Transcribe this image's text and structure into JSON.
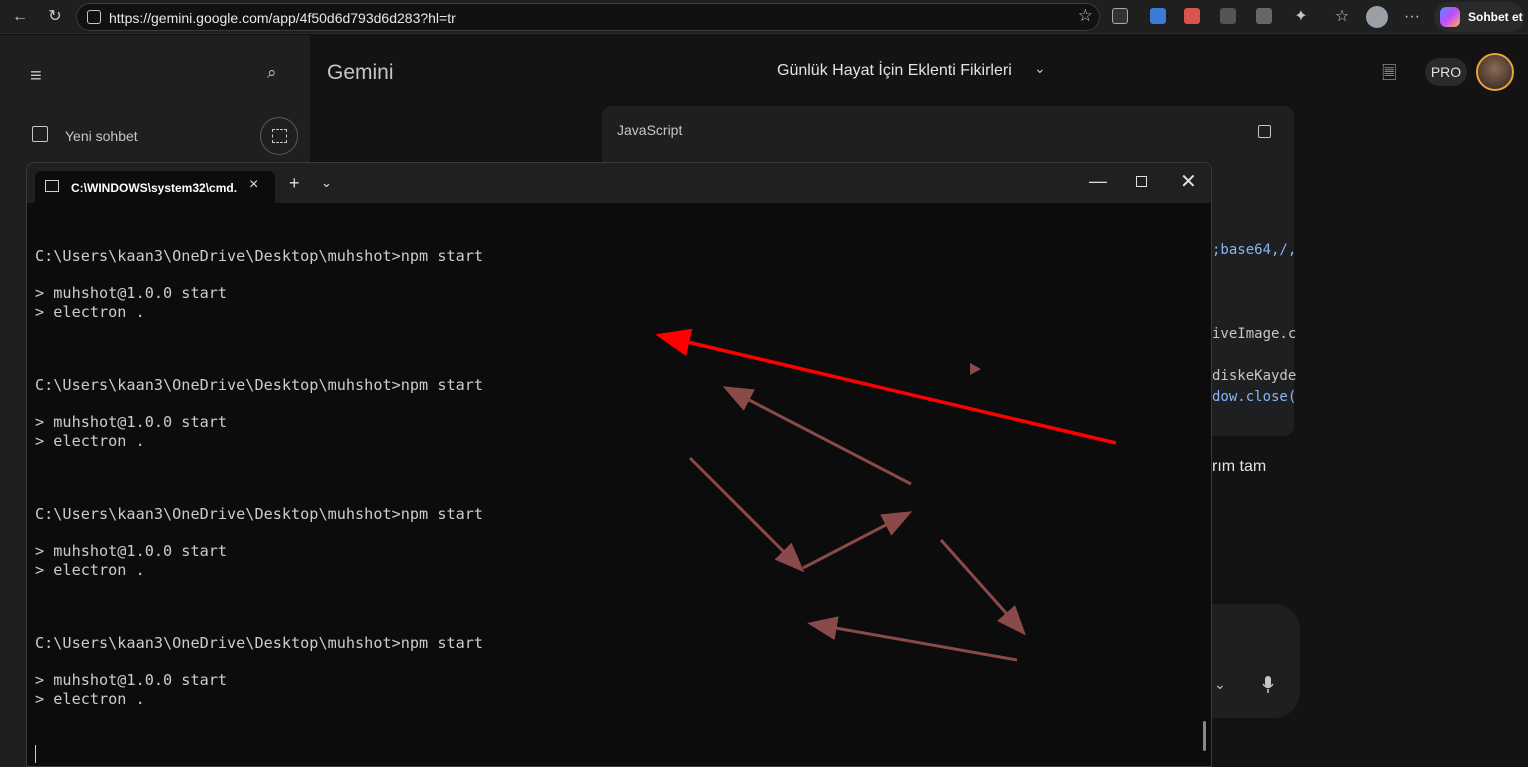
{
  "browser": {
    "url": "https://gemini.google.com/app/4f50d6d793d6d283?hl=tr",
    "copilot_label": "Sohbet et"
  },
  "gemini": {
    "logo": "Gemini",
    "chat_title": "Günlük Hayat İçin Eklenti Fikirleri",
    "new_chat_label": "Yeni sohbet",
    "pro_label": "PRO",
    "code_language": "JavaScript",
    "code_fragments": [
      ";base64,/,",
      "iveImage.c",
      "diskeKayde",
      "dow.close("
    ],
    "reply_fragment": "rım tam"
  },
  "terminal": {
    "tab_title": "C:\\WINDOWS\\system32\\cmd.",
    "lines": [
      "C:\\Users\\kaan3\\OneDrive\\Desktop\\muhshot>npm start",
      "> muhshot@1.0.0 start",
      "> electron .",
      "C:\\Users\\kaan3\\OneDrive\\Desktop\\muhshot>npm start",
      "> muhshot@1.0.0 start",
      "> electron .",
      "C:\\Users\\kaan3\\OneDrive\\Desktop\\muhshot>npm start",
      "> muhshot@1.0.0 start",
      "> electron .",
      "C:\\Users\\kaan3\\OneDrive\\Desktop\\muhshot>npm start",
      "> muhshot@1.0.0 start",
      "> electron ."
    ]
  },
  "colors": {
    "annotation_red": "#ff0000",
    "annotation_brown": "#8b4a4a"
  }
}
